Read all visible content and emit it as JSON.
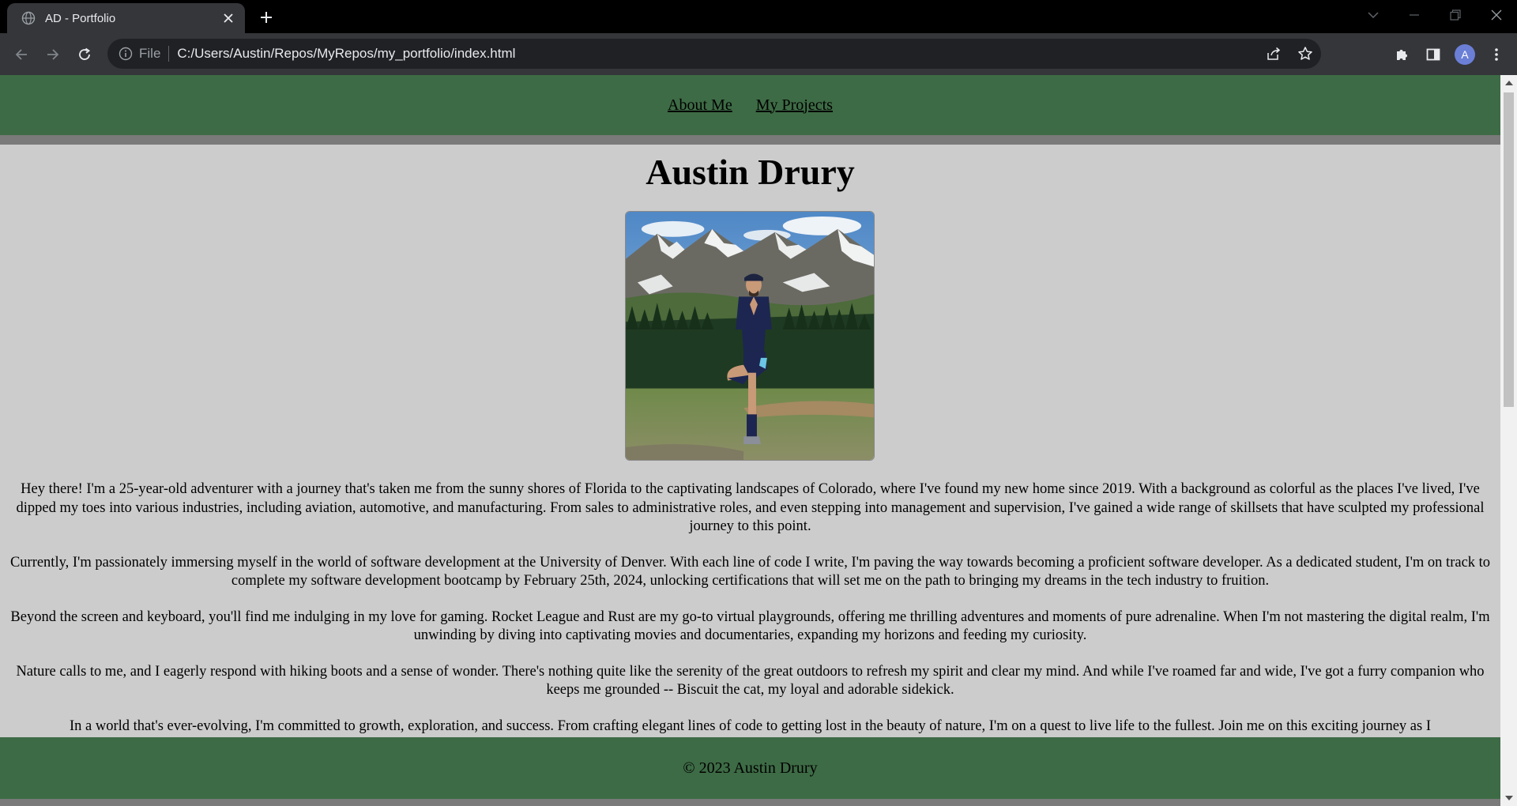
{
  "browser": {
    "tab_title": "AD - Portfolio",
    "url_scheme": "File",
    "url": "C:/Users/Austin/Repos/MyRepos/my_portfolio/index.html",
    "profile_initial": "A"
  },
  "site": {
    "nav": {
      "about": "About Me",
      "projects": "My Projects"
    },
    "title": "Austin Drury",
    "paragraphs": [
      "Hey there! I'm a 25-year-old adventurer with a journey that's taken me from the sunny shores of Florida to the captivating landscapes of Colorado, where I've found my new home since 2019. With a background as colorful as the places I've lived, I've dipped my toes into various industries, including aviation, automotive, and manufacturing. From sales to administrative roles, and even stepping into management and supervision, I've gained a wide range of skillsets that have sculpted my professional journey to this point.",
      "Currently, I'm passionately immersing myself in the world of software development at the University of Denver. With each line of code I write, I'm paving the way towards becoming a proficient software developer. As a dedicated student, I'm on track to complete my software development bootcamp by February 25th, 2024, unlocking certifications that will set me on the path to bringing my dreams in the tech industry to fruition.",
      "Beyond the screen and keyboard, you'll find me indulging in my love for gaming. Rocket League and Rust are my go-to virtual playgrounds, offering me thrilling adventures and moments of pure adrenaline. When I'm not mastering the digital realm, I'm unwinding by diving into captivating movies and documentaries, expanding my horizons and feeding my curiosity.",
      "Nature calls to me, and I eagerly respond with hiking boots and a sense of wonder. There's nothing quite like the serenity of the great outdoors to refresh my spirit and clear my mind. And while I've roamed far and wide, I've got a furry companion who keeps me grounded -- Biscuit the cat, my loyal and adorable sidekick.",
      "In a world that's ever-evolving, I'm committed to growth, exploration, and success. From crafting elegant lines of code to getting lost in the beauty of nature, I'm on a quest to live life to the fullest. Join me on this exciting journey as I"
    ],
    "footer": "© 2023 Austin Drury"
  },
  "colors": {
    "nav_bg": "#3d6b45",
    "page_bg": "#cccccc",
    "border_gray": "#7a7a7a"
  }
}
